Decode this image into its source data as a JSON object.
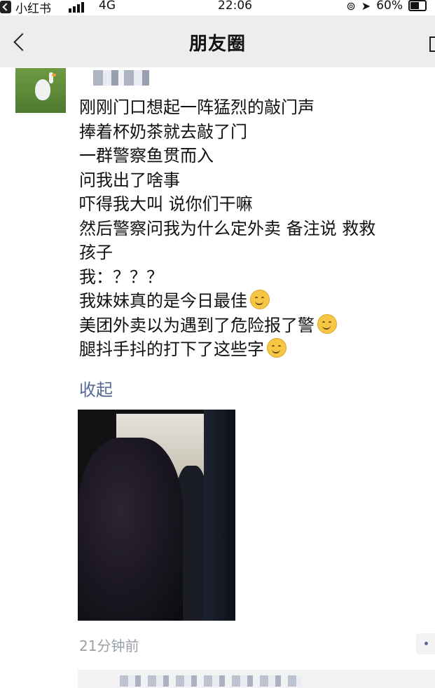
{
  "status_bar": {
    "app_name": "小红书",
    "network": "4G",
    "time": "22:06",
    "battery": "60%"
  },
  "nav": {
    "title": "朋友圈"
  },
  "post": {
    "lines": [
      "刚刚门口想起一阵猛烈的敲门声",
      "捧着杯奶茶就去敲了门",
      "一群警察鱼贯而入",
      "问我出了啥事",
      "吓得我大叫 说你们干嘛",
      "然后警察问我为什么定外卖  备注说  救救",
      "孩子",
      "我：？？？",
      "我妹妹真的是今日最佳",
      "美团外卖以为遇到了危险报了警",
      "腿抖手抖的打下了这些字"
    ],
    "collapse_label": "收起",
    "timestamp": "21分钟前"
  },
  "colors": {
    "link": "#576b95",
    "nav_bg": "#ededed",
    "timestamp": "#9aa0a6"
  }
}
